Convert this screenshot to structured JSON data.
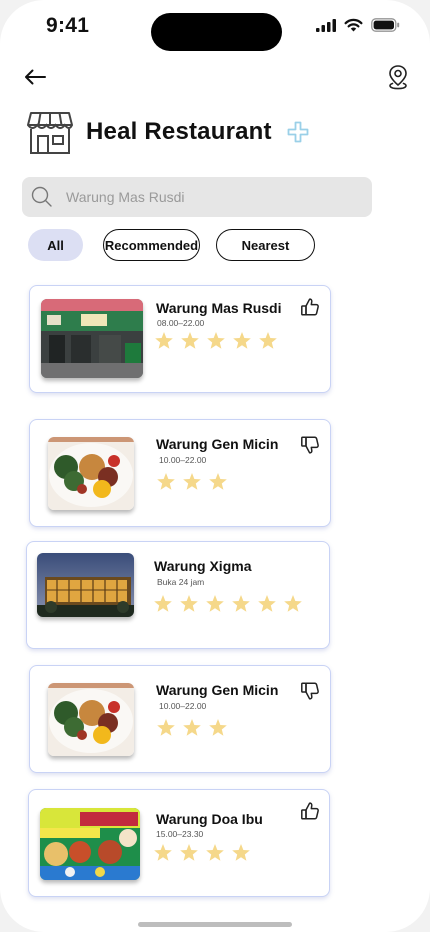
{
  "status_bar": {
    "time": "9:41"
  },
  "header": {
    "title": "Heal Restaurant"
  },
  "search": {
    "placeholder": "Warung Mas Rusdi"
  },
  "filters": [
    "All",
    "Recommended",
    "Nearest"
  ],
  "restaurants": [
    {
      "name": "Warung Mas Rusdi",
      "hours": "08.00–22.00",
      "rating": 5,
      "reaction": "thumbs-up-icon"
    },
    {
      "name": "Warung Gen Micin",
      "hours": "10.00–22.00",
      "rating": 3,
      "reaction": "thumbs-down-icon"
    },
    {
      "name": "Warung Xigma",
      "hours": "Buka 24 jam",
      "rating": 6,
      "reaction": ""
    },
    {
      "name": "Warung Gen Micin",
      "hours": "10.00–22.00",
      "rating": 3,
      "reaction": "thumbs-down-icon"
    },
    {
      "name": "Warung Doa Ibu",
      "hours": "15.00–23.30",
      "rating": 4,
      "reaction": "thumbs-up-icon"
    }
  ],
  "colors": {
    "star": "#f5d88a",
    "chip_active": "#dcdff3",
    "card_border": "#c9d3f5",
    "plus": "#9ad0e8"
  }
}
